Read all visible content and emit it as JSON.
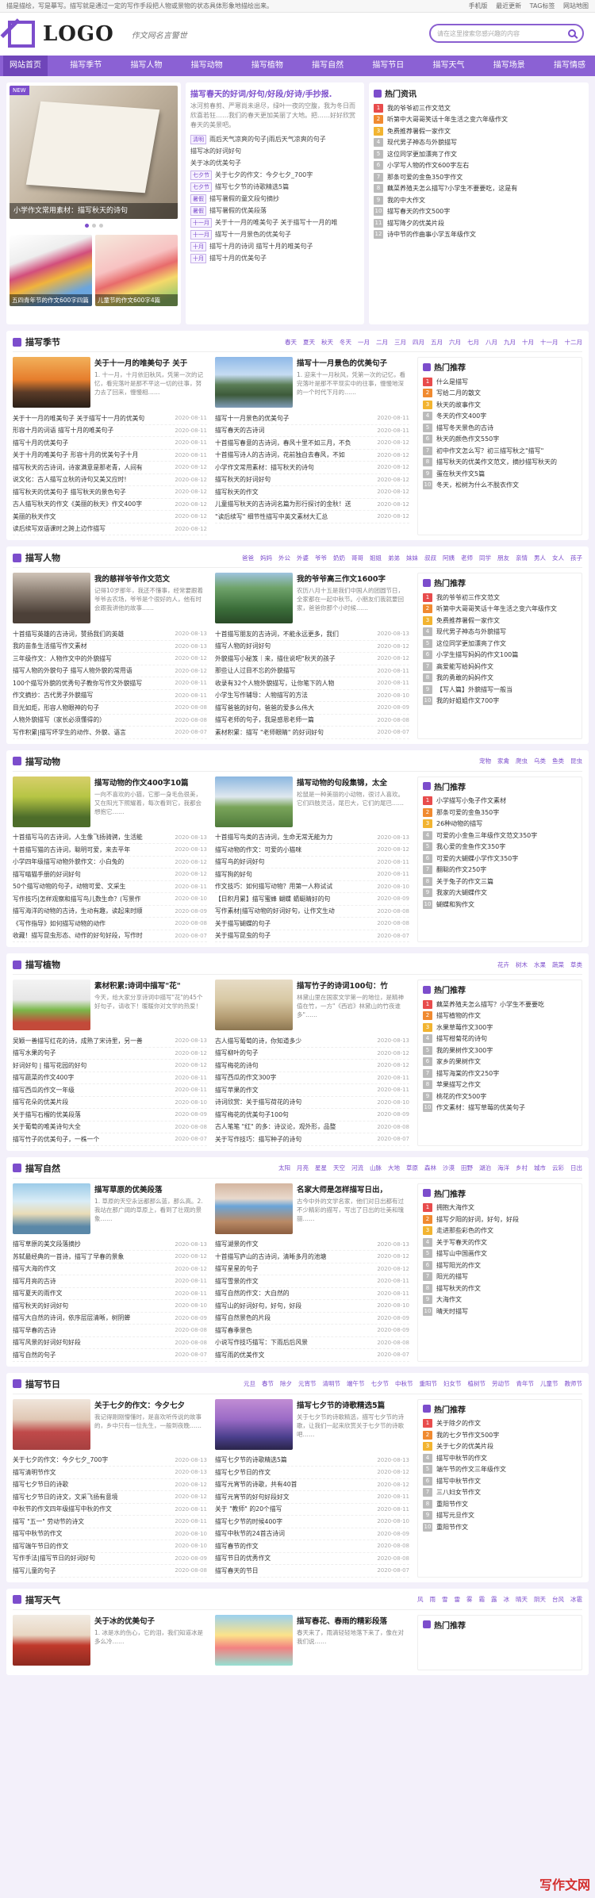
{
  "topbar": {
    "notice": "描是描绘，写是摹写。描写就是通过一定的写作手段把人物或景物的状态具体形象地描绘出来。",
    "links": [
      "手机版",
      "最近更新",
      "TAG标签",
      "网站地图"
    ]
  },
  "header": {
    "logo": "LOGO",
    "slogan": "作文网名言警世",
    "search_placeholder": "请在这里搜索您感兴趣的内容"
  },
  "nav": [
    "网站首页",
    "描写季节",
    "描写人物",
    "描写动物",
    "描写植物",
    "描写自然",
    "描写节日",
    "描写天气",
    "描写场景",
    "描写情感"
  ],
  "slider": {
    "new": "NEW",
    "caption": "小学作文常用素材：描写秋天的诗句",
    "thumb1": "五四青年节的作文600字四篇",
    "thumb2": "儿童节的作文600字4篇"
  },
  "middle": {
    "title": "描写春天的好词/好句/好段/好诗/手抄报.",
    "desc": "冰河剪春剪、严寒尚未退尽，绿叶一夜的空腹，我为冬日而欣喜若狂……我们的春天更加美丽了大地。把……好好欣赏春天的美景吧。",
    "items": [
      {
        "tag": "清明",
        "text": "雨后天气凉爽的句子|雨后天气凉爽的句子"
      },
      {
        "tag": "",
        "text": "描写冰的好词好句"
      },
      {
        "tag": "",
        "text": "关于冰的优美句子"
      },
      {
        "tag": "七夕节",
        "text": "关于七夕的作文：今夕七夕_700字"
      },
      {
        "tag": "七夕节",
        "text": "描写七夕节的诗歌精选5篇"
      },
      {
        "tag": "暑假",
        "text": "描写暑假的童文段句摘抄"
      },
      {
        "tag": "暑假",
        "text": "描写暑假的优美段落"
      },
      {
        "tag": "十一月",
        "text": "关于十一月的唯美句子 关于描写十一月的唯"
      },
      {
        "tag": "十一月",
        "text": "描写十一月景色的优美句子"
      },
      {
        "tag": "十月",
        "text": "描写十月的诗词 描写十月的唯美句子"
      },
      {
        "tag": "十月",
        "text": "描写十月的优美句子"
      }
    ]
  },
  "hot": {
    "title": "热门资讯",
    "items": [
      "我的爷爷初三作文范文",
      "听第中大哥哥笑话十年生活之变六年级作文",
      "免费推荐暑假一家作文",
      "现代男子神态与外貌描写",
      "这位同学更加漂亮了作文",
      "小学写人物的作文600字左右",
      "那条可爱的金鱼350字作文",
      "藕菜养殖夫怎么描写?小学生不要要吃，这是有",
      "我的中大作文",
      "描写春天的作文500字",
      "描写降夕的优美片段",
      "诗中节的作曲事小学五年级作文"
    ]
  },
  "sections": [
    {
      "title": "描写季节",
      "tags": [
        "春天",
        "夏天",
        "秋天",
        "冬天",
        "一月",
        "二月",
        "三月",
        "四月",
        "五月",
        "六月",
        "七月",
        "八月",
        "九月",
        "十月",
        "十一月",
        "十二月"
      ],
      "f1": {
        "title": "关于十一月的唯美句子 关于",
        "desc": "1. 十一月，十月依旧秋风，凭第一次的记忆，看完落叶是那不平这一切的往事，努力去了回来，慢慢相……"
      },
      "f2": {
        "title": "描写十一月景色的优美句子",
        "desc": "1. 迎来十一月秋风，凭第一次的记忆，看完落叶是那不平现实中的往事，慢慢地深的一个时代下月的……"
      },
      "col1": [
        [
          "关于十一月的唯美句子 关于描写十一月的优美句",
          "2020-08-11"
        ],
        [
          "形容十月的词语 描写十月的唯美句子",
          "2020-08-11"
        ],
        [
          "描写十月的优美句子",
          "2020-08-11"
        ],
        [
          "关于十月的唯美句子 形容十月的优美句子十月",
          "2020-08-11"
        ],
        [
          "描写秋天的古诗词，诗家满意是那老青，人间有",
          "2020-08-12"
        ],
        [
          "说文化：古人描写立秋的诗句又美又应时!",
          "2020-08-12"
        ],
        [
          "描写秋天的优美句子 描写秋天的景色句子",
          "2020-08-12"
        ],
        [
          "古人描写秋天的作文《美丽的秋天》作文400字",
          "2020-08-12"
        ],
        [
          "美丽的秋天作文",
          "2020-08-12"
        ],
        [
          "读后续写双语课时之跨上边作描写",
          "2020-08-12"
        ]
      ],
      "col2": [
        [
          "描写十一月景色的优美句子",
          "2020-08-11"
        ],
        [
          "描写春天的古诗词",
          "2020-08-11"
        ],
        [
          "十首描写春意的古诗词，春风十里不如三月，不负",
          "2020-08-12"
        ],
        [
          "十首描写诗人的古诗词，花前独自去春风，不如",
          "2020-08-12"
        ],
        [
          "小学作文常用素材：描写秋天的诗句",
          "2020-08-12"
        ],
        [
          "描写秋天的好词好句",
          "2020-08-12"
        ],
        [
          "描写秋天的作文",
          "2020-08-12"
        ],
        [
          "儿童描写秋天的古诗词名篇为形行探讨的金秋！送",
          "2020-08-12"
        ],
        [
          "\"读后续写\" 细节性描写中英文素材大汇总",
          "2020-08-12"
        ],
        [
          "",
          ""
        ]
      ],
      "hot": [
        "什么是描写",
        "写给二月的散文",
        "秋天的故事作文",
        "冬天的作文400字",
        "描写冬天景色的古诗",
        "秋天的颜色作文550字",
        "初中作文怎么写？初三描写秋之\"描写\"",
        "描写秋天的优美作文范文，摘抄描写秋天的",
        "蛋在秋天作文5篇",
        "冬天，松树为什么不脱衣作文"
      ]
    },
    {
      "title": "描写人物",
      "tags": [
        "爸爸",
        "妈妈",
        "外公",
        "外婆",
        "爷爷",
        "奶奶",
        "哥哥",
        "姐姐",
        "弟弟",
        "妹妹",
        "叔叔",
        "阿姨",
        "老师",
        "同学",
        "朋友",
        "亲情",
        "男人",
        "女人",
        "孩子"
      ],
      "f1": {
        "title": "我的慈祥爷爷作文范文",
        "desc": "记得10岁那年，我还不懂事，经常要跟着爷爷去农场，爷爷是个很好的人，他有时会跟我讲他的故事……"
      },
      "f2": {
        "title": "我的爷爷高三作文1600字",
        "desc": "农历八月十五是我们中国人的团圆节日，全家都在一起中秋节。小朋友们我就要回家，爸爸你那个小时候……"
      },
      "col1": [
        [
          "十首描写英雄的古诗词，赞扬我们的英雄",
          "2020-08-13"
        ],
        [
          "我的苗条生活描写作文素材",
          "2020-08-13"
        ],
        [
          "三年级作文：人物作文中的外貌描写",
          "2020-08-12"
        ],
        [
          "描写人物的外貌句子 描写人物外貌的常用语",
          "2020-08-12"
        ],
        [
          "100个描写外貌的优秀句子教你写作文外貌描写",
          "2020-08-11"
        ],
        [
          "作文摘抄：古代男子外貌描写",
          "2020-08-11"
        ],
        [
          "目光如炬，形容人物眼神的句子",
          "2020-08-08"
        ],
        [
          "人物外貌描写（家长必须懂得的）",
          "2020-08-08"
        ],
        [
          "写作积累|描写坏学生的动作、外貌、语言",
          "2020-08-07"
        ],
        [
          "",
          ""
        ]
      ],
      "col2": [
        [
          "十首描写朋友的古诗词，不能永远更多，我们",
          "2020-08-13"
        ],
        [
          "描写人物的好词好句",
          "2020-08-12"
        ],
        [
          "外貌描写小秘笈｜来，描住说吧\"秋天的孩子",
          "2020-08-12"
        ],
        [
          "那些让人过目不忘的外貌描写",
          "2020-08-11"
        ],
        [
          "收录有32个人物外貌描写，让你笔下的人物",
          "2020-08-11"
        ],
        [
          "小学生写作辅导：人物描写的方法",
          "2020-08-10"
        ],
        [
          "描写爸爸的好句，爸爸的爱多么伟大",
          "2020-08-09"
        ],
        [
          "描写老师的句子，我是感恩老师一篇",
          "2020-08-08"
        ],
        [
          "素材积累：描写 \"老师眼睛\" 的好词好句",
          "2020-08-07"
        ],
        [
          "",
          ""
        ]
      ],
      "hot": [
        "我的爷爷初三作文范文",
        "听第中大哥哥笑话十年生活之变六年级作文",
        "免费推荐暑假一家作文",
        "现代男子神态与外貌描写",
        "这位同学更加漂亮了作文",
        "小学生描写妈妈的作文100篇",
        "高爱能写给妈妈作文",
        "我的勇敢的妈妈作文",
        "【写人篇】外貌描写一般当",
        "我的好姐姐作文700字"
      ]
    },
    {
      "title": "描写动物",
      "tags": [
        "宠物",
        "家禽",
        "爬虫",
        "乌类",
        "鱼类",
        "昆虫"
      ],
      "f1": {
        "title": "描写动物的作文400字10篇",
        "desc": "一向不喜欢的小猫，它那一身毛色很美，又在阳光下照耀着，每次看到它，我都会想抱它……"
      },
      "f2": {
        "title": "描写动物的句段集锦，太全",
        "desc": "松鼠是一种美丽的小动物，很讨人喜欢。它们四肢灵活，尾巴大，它们的尾巴……"
      },
      "col1": [
        [
          "十首描写马的古诗词，人生像飞扬骑骋，生活能",
          "2020-08-13"
        ],
        [
          "十首描写猫的古诗词，聪明可爱，来去平年",
          "2020-08-13"
        ],
        [
          "小学四年级描写动物外貌作文：小白兔的",
          "2020-08-12"
        ],
        [
          "描写喵猫手册的好词好句",
          "2020-08-12"
        ],
        [
          "50个描写动物的句子，动物可爱、文采生",
          "2020-08-11"
        ],
        [
          "写作技巧|怎样观察和描写鸟儿数生命？(写景作",
          "2020-08-10"
        ],
        [
          "描写海洋的动物的古诗，生动有趣，读起来时顺",
          "2020-08-09"
        ],
        [
          "《写作指导》如何描写动物的动作",
          "2020-08-08"
        ],
        [
          "收藏！描写昆虫形态、动作的好句好段，写作时",
          "2020-08-07"
        ],
        [
          "",
          ""
        ]
      ],
      "col2": [
        [
          "十首描写鸟类的古诗词，生命无常无能为力",
          "2020-08-13"
        ],
        [
          "描写动物的作文：可爱的小猫咪",
          "2020-08-12"
        ],
        [
          "描写鸟的好词好句",
          "2020-08-11"
        ],
        [
          "描写狗的好句",
          "2020-08-11"
        ],
        [
          "作文技巧：如何描写动物？用第一人称试试",
          "2020-08-10"
        ],
        [
          "【日积月累】描写蜜蜂 蝴蝶 蜻蜓睛好的句",
          "2020-08-09"
        ],
        [
          "写作素材|描写动物的好词好句，让作文生动",
          "2020-08-08"
        ],
        [
          "关于描写蝴蝶的句子",
          "2020-08-08"
        ],
        [
          "关于描写昆虫的句子",
          "2020-08-07"
        ],
        [
          "",
          ""
        ]
      ],
      "hot": [
        "小学描写小兔子作文素材",
        "那条可爱的金鱼350字",
        "26种动物的描写",
        "可爱的小金鱼三年级作文范文350字",
        "我心爱的金鱼作文350字",
        "可爱的大蝴蝶小学作文350字",
        "翻聪的作文250字",
        "关于兔子的作文三篇",
        "我家的大蝴蝶作文",
        "蝴蝶和狗作文"
      ]
    },
    {
      "title": "描写植物",
      "tags": [
        "花卉",
        "树木",
        "水果",
        "蔬菜",
        "草类"
      ],
      "f1": {
        "title": "素材积累:诗词中描写\"花\"",
        "desc": "今天，给大家分享诗词中描写\"花\"的45个好句子，请收下！暖暖你对文学的热爱！"
      },
      "f2": {
        "title": "描写竹子的诗词100句：竹",
        "desc": "林黛山里在国家文学第一的地位，是精神值在竹，一方\"《西岩》林黛山的竹夜谁多\"……"
      },
      "col1": [
        [
          "吴颖一善描写红花的诗，成熟了宋诗里，另一善",
          "2020-08-13"
        ],
        [
          "描写水果的句子",
          "2020-08-12"
        ],
        [
          "好词好句 | 描写花园的好句",
          "2020-08-12"
        ],
        [
          "描写蔬菜的作文400字",
          "2020-08-11"
        ],
        [
          "描写西瓜的作文一年级",
          "2020-08-11"
        ],
        [
          "描写花朵的优美片段",
          "2020-08-10"
        ],
        [
          "关于描写石榴的优美段落",
          "2020-08-09"
        ],
        [
          "关于葡萄的唯美诗句大全",
          "2020-08-08"
        ],
        [
          "描写竹子的优美句子，一株一个",
          "2020-08-07"
        ],
        [
          "",
          ""
        ]
      ],
      "col2": [
        [
          "古人描写葡萄的诗，你知道多少",
          "2020-08-13"
        ],
        [
          "描写柳叶的句子",
          "2020-08-12"
        ],
        [
          "描写梅花的诗句",
          "2020-08-12"
        ],
        [
          "描写西瓜的作文300字",
          "2020-08-11"
        ],
        [
          "描写苹果的作文",
          "2020-08-11"
        ],
        [
          "诗词欣赏：关于描写荷花的诗句",
          "2020-08-10"
        ],
        [
          "描写梅花的优美句子100句",
          "2020-08-09"
        ],
        [
          "古人笔笔 \"红\" 的多：诗议论，观外形，品整",
          "2020-08-08"
        ],
        [
          "关于写作技巧：描写种子的诗句",
          "2020-08-07"
        ],
        [
          "",
          ""
        ]
      ],
      "hot": [
        "藕菜养殖夫怎么描写？小学生不要要吃",
        "描写植物的作文",
        "水果草莓作文300字",
        "描写柑菊花的诗句",
        "我的果树作文300字",
        "家乡的果树作文",
        "描写海棠的作文250字",
        "苹果描写之作文",
        "桃花的作文500字",
        "作文素材：描写草莓的优美句子"
      ]
    },
    {
      "title": "描写自然",
      "tags": [
        "太阳",
        "月亮",
        "星星",
        "天空",
        "河流",
        "山脉",
        "大地",
        "草原",
        "森林",
        "沙漠",
        "田野",
        "湖泊",
        "海洋",
        "乡村",
        "城市",
        "云彩",
        "日出"
      ],
      "f1": {
        "title": "描写草原的优美段落",
        "desc": "1. 草原的天空永远都那么蓝，那么高。2. 我站在那广阔的草原上，看到了壮观的景象……"
      },
      "f2": {
        "title": "名家大师是怎样描写日出，",
        "desc": "古今中外的文学名家，他们对日出都有过不少精彩的描写，写出了日出的壮美和瑰丽……"
      },
      "col1": [
        [
          "描写草原的美文段落摘抄",
          "2020-08-13"
        ],
        [
          "苏轼最经典的一首诗，描写了早春的景象",
          "2020-08-12"
        ],
        [
          "描写大海的作文",
          "2020-08-12"
        ],
        [
          "描写月亮的古诗",
          "2020-08-11"
        ],
        [
          "描写夏天的雨作文",
          "2020-08-11"
        ],
        [
          "描写秋天的好词好句",
          "2020-08-10"
        ],
        [
          "描写大自然的诗词，依序层层清晰，树阴蝉",
          "2020-08-09"
        ],
        [
          "描写早春的古诗",
          "2020-08-08"
        ],
        [
          "描写风景的好词好句好段",
          "2020-08-08"
        ],
        [
          "描写自然的句子",
          "2020-08-07"
        ]
      ],
      "col2": [
        [
          "描写湖景的作文",
          "2020-08-13"
        ],
        [
          "十首描写庐山的古诗词，清晰多月的池塘",
          "2020-08-12"
        ],
        [
          "描写星星的句子",
          "2020-08-12"
        ],
        [
          "描写雪景的作文",
          "2020-08-11"
        ],
        [
          "描写自然的作文：大自然的",
          "2020-08-11"
        ],
        [
          "描写山的好词好句，好句，好段",
          "2020-08-10"
        ],
        [
          "描写自然景色的片段",
          "2020-08-09"
        ],
        [
          "描写春季景色",
          "2020-08-09"
        ],
        [
          "小说写作技巧描写：下雨后后风景",
          "2020-08-08"
        ],
        [
          "描写雨的优美作文",
          "2020-08-07"
        ]
      ],
      "hot": [
        "拥抱大海作文",
        "描写夕阳的好词，好句，好段",
        "走进那些彩色的作文",
        "关于写春天的作文",
        "描写山中国画作文",
        "描写阳光的作文",
        "阳光的描写",
        "描写秋天的作文",
        "大海作文",
        "晴天时描写"
      ]
    },
    {
      "title": "描写节日",
      "tags": [
        "元旦",
        "春节",
        "除夕",
        "元宵节",
        "清明节",
        "端午节",
        "七夕节",
        "中秋节",
        "重阳节",
        "妇女节",
        "植树节",
        "劳动节",
        "青年节",
        "儿童节",
        "教师节"
      ],
      "f1": {
        "title": "关于七夕的作文：今夕七夕",
        "desc": "我记得刚刚懵懂时，是喜欢听传说的故事的，乡中只有一位先生，一般到夜晚……"
      },
      "f2": {
        "title": "描写七夕节的诗歌精选5篇",
        "desc": "关于七夕节的诗歌精选，描写七夕节的诗歌，让我们一起来欣赏关于七夕节的诗歌吧……"
      },
      "col1": [
        [
          "关于七夕的作文：今夕七夕_700字",
          "2020-08-13"
        ],
        [
          "描写清明节作文",
          "2020-08-13"
        ],
        [
          "描写七夕节日的诗歌",
          "2020-08-12"
        ],
        [
          "描写七夕节日的诗文，文采飞扬有意境",
          "2020-08-12"
        ],
        [
          "中秋节的作文四年级描写中秋的作文",
          "2020-08-11"
        ],
        [
          "描写 \"五一\" 劳动节的诗文",
          "2020-08-11"
        ],
        [
          "描写中秋节的作文",
          "2020-08-10"
        ],
        [
          "描写端午节日的作文",
          "2020-08-10"
        ],
        [
          "写作手法|描写节日的好词好句",
          "2020-08-09"
        ],
        [
          "描写儿童的句子",
          "2020-08-08"
        ]
      ],
      "col2": [
        [
          "描写七夕节的诗歌精选5篇",
          "2020-08-13"
        ],
        [
          "描写七夕节日的作文",
          "2020-08-12"
        ],
        [
          "描写元宵节的诗歌，共有40首",
          "2020-08-12"
        ],
        [
          "描写元宵节的好句好段好文",
          "2020-08-11"
        ],
        [
          "关于 \"教师\" 的20个描写",
          "2020-08-11"
        ],
        [
          "描写七夕节的时候400字",
          "2020-08-10"
        ],
        [
          "描写中秋节的24首古诗词",
          "2020-08-09"
        ],
        [
          "描写春节的作文",
          "2020-08-08"
        ],
        [
          "描写节日的优秀作文",
          "2020-08-08"
        ],
        [
          "描写春天的节日",
          "2020-08-07"
        ]
      ],
      "hot": [
        "关于除夕的作文",
        "我的七夕节作文500字",
        "关于七夕的优美片段",
        "描写中秋节的作文",
        "端午节的作文三年级作文",
        "描写中秋节作文",
        "三八妇女节作文",
        "重阳节作文",
        "描写元旦作文",
        "重阳节作文"
      ]
    },
    {
      "title": "描写天气",
      "tags": [
        "风",
        "雨",
        "雪",
        "雷",
        "雾",
        "霜",
        "露",
        "冰",
        "晴天",
        "阴天",
        "台风",
        "冰雹"
      ],
      "f1": {
        "title": "关于冰的优美句子",
        "desc": "1. 冰是水的伤心，它的泪，我们知道冰是多么冷……"
      },
      "f2": {
        "title": "描写春花、春雨的精彩段落",
        "desc": "春天来了，雨滴轻轻地落下来了，像在对我们说……"
      },
      "col1": [],
      "col2": [],
      "hot": []
    }
  ],
  "watermark": "写作文网"
}
